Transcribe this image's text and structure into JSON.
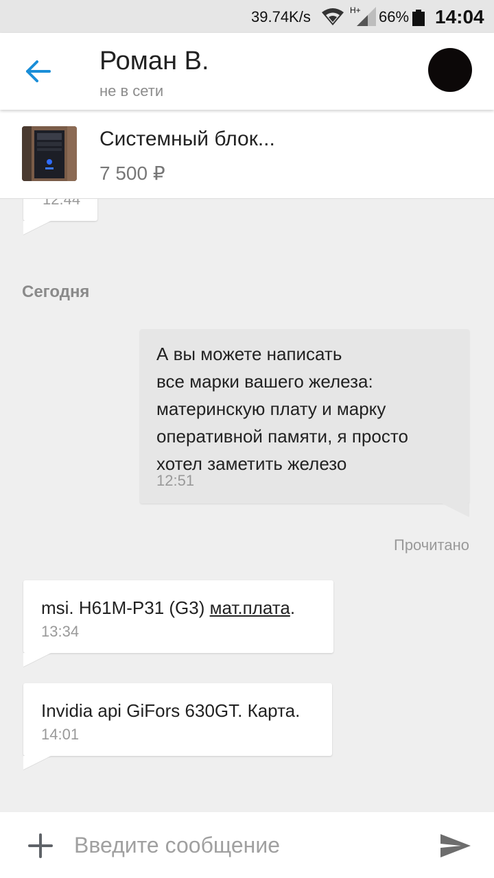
{
  "status_bar": {
    "net_speed": "39.74K/s",
    "network_type": "H+",
    "battery": "66%",
    "time": "14:04"
  },
  "header": {
    "name": "Роман В.",
    "status": "не в сети"
  },
  "listing": {
    "title": "Системный блок...",
    "price": "7 500 ₽"
  },
  "chat": {
    "partial_time": "12:44",
    "date_separator": "Сегодня",
    "messages": [
      {
        "direction": "outgoing",
        "text": "А вы можете написать\nвсе марки вашего железа:\nматеринскую плату и марку\nоперативной памяти, я просто\nхотел заметить железо",
        "time": "12:51"
      },
      {
        "direction": "incoming",
        "text_before_link": "msi. H61M-P31 (G3) ",
        "link": "мат.плата",
        "text_after_link": ".",
        "time": "13:34"
      },
      {
        "direction": "incoming",
        "text": "Invidia api GiFors 630GT. Карта.",
        "time": "14:01"
      }
    ],
    "read_receipt": "Прочитано"
  },
  "composer": {
    "placeholder": "Введите сообщение",
    "value": ""
  },
  "colors": {
    "accent": "#1a8ed8",
    "background": "#efefef",
    "outgoing_bubble": "#e6e6e6",
    "incoming_bubble": "#ffffff"
  },
  "icons": {
    "back": "arrow-left-icon",
    "attach": "plus-icon",
    "send": "send-icon",
    "wifi": "wifi-icon",
    "signal": "signal-icon",
    "battery": "battery-icon"
  }
}
